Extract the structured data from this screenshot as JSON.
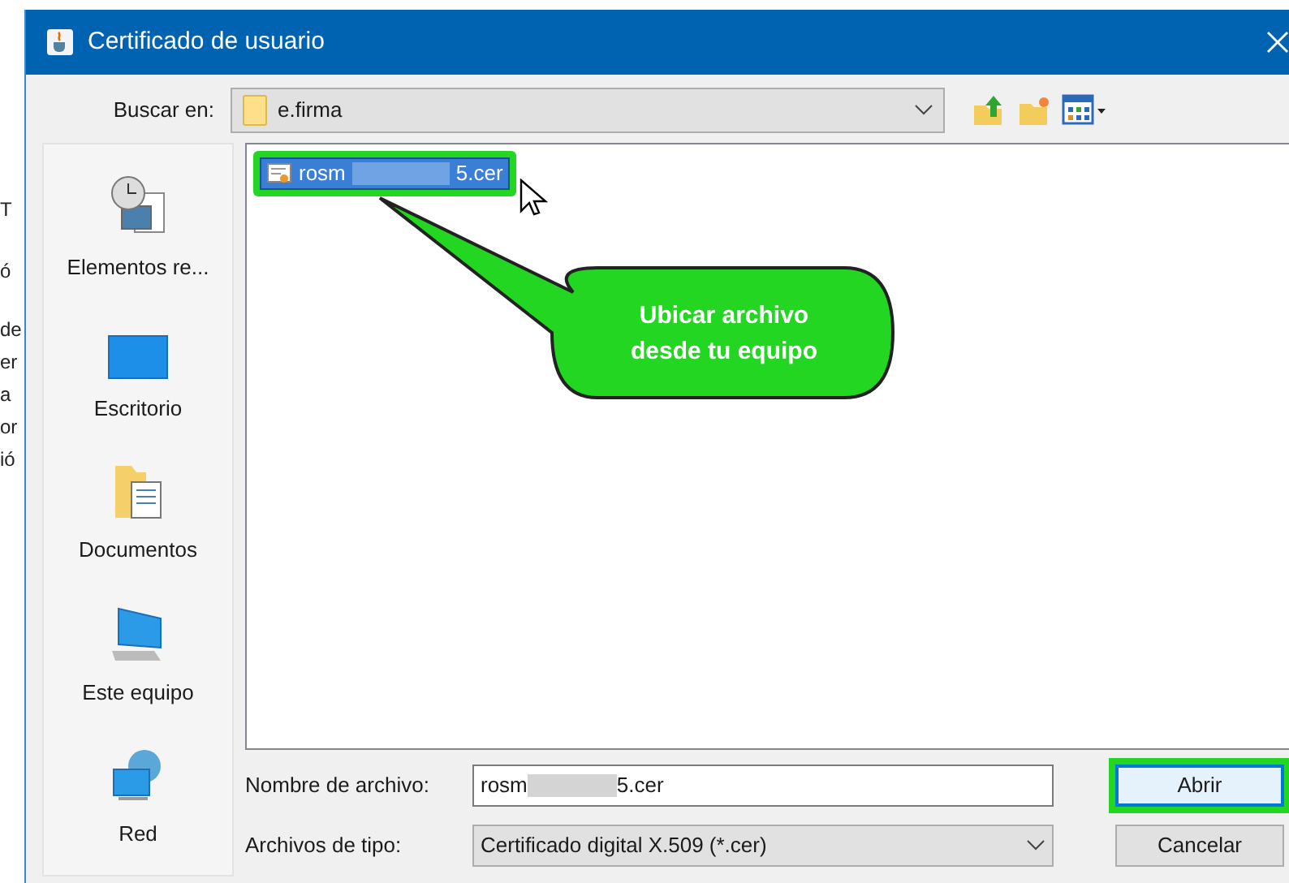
{
  "background_window": {
    "fragments": [
      "T",
      "ó",
      "de",
      "er",
      "a",
      "or",
      "ió"
    ]
  },
  "window": {
    "title": "Certificado de usuario"
  },
  "look_in": {
    "label": "Buscar en:",
    "value": "e.firma"
  },
  "places": [
    {
      "kind": "recent",
      "label": "Elementos re..."
    },
    {
      "kind": "desktop",
      "label": "Escritorio"
    },
    {
      "kind": "documents",
      "label": "Documentos"
    },
    {
      "kind": "computer",
      "label": "Este equipo"
    },
    {
      "kind": "network",
      "label": "Red"
    }
  ],
  "files": [
    {
      "name_start": "rosm",
      "name_end": "5.cer",
      "selected": true,
      "highlighted": true
    }
  ],
  "callout": {
    "text": "Ubicar archivo desde tu equipo"
  },
  "file_name": {
    "label": "Nombre de archivo:",
    "value_start": "rosm",
    "value_end": "5.cer"
  },
  "file_type": {
    "label": "Archivos de tipo:",
    "value": "Certificado digital X.509 (*.cer)"
  },
  "buttons": [
    {
      "label": "Abrir",
      "highlighted": true
    },
    {
      "label": "Cancelar",
      "highlighted": false
    }
  ]
}
